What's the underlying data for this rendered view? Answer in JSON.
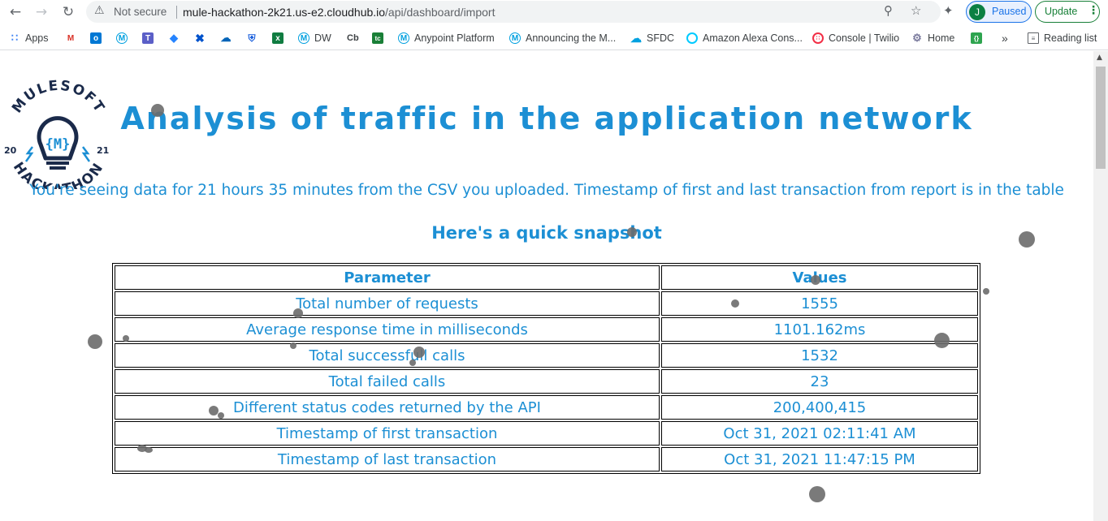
{
  "browser": {
    "security_label": "Not secure",
    "url_host": "mule-hackathon-2k21.us-e2.cloudhub.io",
    "url_path": "/api/dashboard/import",
    "profile_initial": "J",
    "profile_status": "Paused",
    "update_label": "Update",
    "bookmarks": [
      {
        "label": "Apps",
        "icon": "apps-grid-icon",
        "color": "#4285f4"
      },
      {
        "label": "",
        "icon": "gmail-icon",
        "color": "#d93025"
      },
      {
        "label": "",
        "icon": "outlook-icon",
        "color": "#0078d4"
      },
      {
        "label": "",
        "icon": "mulesoft-icon",
        "color": "#00a0df"
      },
      {
        "label": "",
        "icon": "teams-icon",
        "color": "#5b5fc7"
      },
      {
        "label": "",
        "icon": "jira-icon",
        "color": "#2684ff"
      },
      {
        "label": "",
        "icon": "confluence-icon",
        "color": "#0052cc"
      },
      {
        "label": "",
        "icon": "onedrive-icon",
        "color": "#0364b8"
      },
      {
        "label": "",
        "icon": "bitwarden-icon",
        "color": "#175ddc"
      },
      {
        "label": "",
        "icon": "excel-icon",
        "color": "#107c41"
      },
      {
        "label": "DW",
        "icon": "mulesoft-icon",
        "color": "#00a0df"
      },
      {
        "label": "Cb",
        "icon": "",
        "color": "#3c4043"
      },
      {
        "label": "",
        "icon": "tc-icon",
        "color": "#1a7f37"
      },
      {
        "label": "Anypoint Platform",
        "icon": "mulesoft-icon",
        "color": "#00a0df"
      },
      {
        "label": "Announcing the M...",
        "icon": "mulesoft-icon",
        "color": "#00a0df"
      },
      {
        "label": "SFDC",
        "icon": "salesforce-icon",
        "color": "#00a1e0"
      },
      {
        "label": "Amazon Alexa Cons...",
        "icon": "alexa-icon",
        "color": "#00caff"
      },
      {
        "label": "Console | Twilio",
        "icon": "twilio-icon",
        "color": "#f22f46"
      },
      {
        "label": "Home",
        "icon": "home-gear-icon",
        "color": "#7a7a9d"
      },
      {
        "label": "",
        "icon": "code-braces-icon",
        "color": "#2ea44f"
      },
      {
        "label": "»",
        "icon": "",
        "color": "#3c4043"
      },
      {
        "label": "Reading list",
        "icon": "reading-list-icon",
        "color": "#3c4043"
      }
    ]
  },
  "page": {
    "logo_top": "MULESOFT",
    "logo_bottom": "HACKATHON",
    "logo_year_left": "20",
    "logo_year_right": "21",
    "title": "Analysis of traffic in the application network",
    "subtitle": "You're seeing data for 21 hours 35 minutes from the CSV you uploaded. Timestamp of first and last transaction from report is in the table",
    "snapshot_heading": "Here's a quick snapshot",
    "table": {
      "headers": [
        "Parameter",
        "Values"
      ],
      "rows": [
        [
          "Total number of requests",
          "1555"
        ],
        [
          "Average response time in milliseconds",
          "1101.162ms"
        ],
        [
          "Total successfull calls",
          "1532"
        ],
        [
          "Total failed calls",
          "23"
        ],
        [
          "Different status codes returned by the API",
          "200,400,415"
        ],
        [
          "Timestamp of first transaction",
          "Oct 31, 2021 02:11:41 AM"
        ],
        [
          "Timestamp of last transaction",
          "Oct 31, 2021 11:47:15 PM"
        ]
      ]
    },
    "accent_color": "#1c8fd4"
  }
}
